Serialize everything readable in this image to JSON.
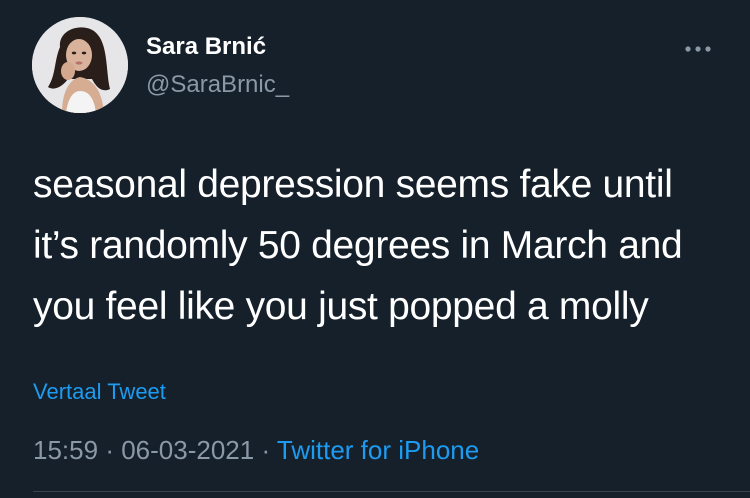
{
  "author": {
    "display_name": "Sara Brnić",
    "handle": "@SaraBrnic_",
    "avatar_icon": "profile-photo"
  },
  "more_icon": "more-horizontal-icon",
  "tweet": {
    "lines": [
      "seasonal depression seems fake until",
      "it’s randomly 50 degrees in March and",
      "you feel like you just popped a molly"
    ]
  },
  "translate_label": "Vertaal Tweet",
  "meta": {
    "time": "15:59",
    "separator": "·",
    "date": "06-03-2021",
    "source": "Twitter for iPhone"
  },
  "colors": {
    "background": "#15202b",
    "text": "#ffffff",
    "secondary": "#8b98a5",
    "link": "#1d9bf0",
    "divider": "#38444d"
  }
}
